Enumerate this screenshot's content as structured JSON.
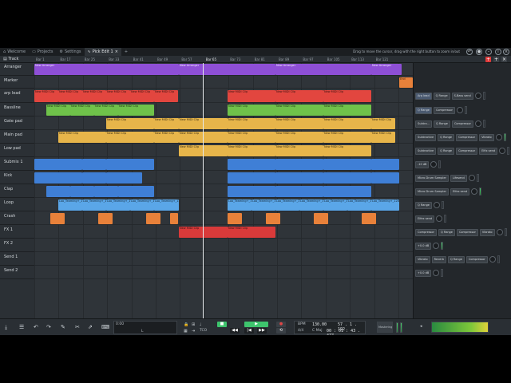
{
  "colors": {
    "arranger": "#8e4fd6",
    "red": "#e2463f",
    "green": "#6fc24a",
    "yellow": "#e7b54a",
    "blue": "#3f7fd6",
    "lightblue": "#5aa6e8",
    "orange": "#e8813a",
    "accent_green": "#3ec46d"
  },
  "tabs": [
    {
      "label": "Welcome",
      "icon": "home-icon"
    },
    {
      "label": "Projects",
      "icon": "folder-icon"
    },
    {
      "label": "Settings",
      "icon": "gear-icon"
    },
    {
      "label": "Pick Edit 1",
      "icon": "waveform-icon",
      "active": true
    }
  ],
  "tab_close": "×",
  "tab_add": "+",
  "hint": "Drag to move the cursor, drag with the right button to zoom in/out",
  "toolbar": {
    "track_label": "Track"
  },
  "ruler": [
    "Bar 1",
    "Bar 17",
    "Bar 25",
    "Bar 33",
    "Bar 41",
    "Bar 49",
    "Bar 57",
    "Bar 65",
    "Bar 73",
    "Bar 81",
    "Bar 89",
    "Bar 97",
    "Bar 105",
    "Bar 113",
    "Bar 121"
  ],
  "tracks": [
    {
      "name": "Arranger"
    },
    {
      "name": "Marker"
    },
    {
      "name": "arp lead"
    },
    {
      "name": "Bassline"
    },
    {
      "name": "Gate pad"
    },
    {
      "name": "Main pad"
    },
    {
      "name": "Low pad"
    },
    {
      "name": "Submix 1"
    },
    {
      "name": "Kick"
    },
    {
      "name": "Clap"
    },
    {
      "name": "Loop"
    },
    {
      "name": "Crash"
    },
    {
      "name": "FX 1"
    },
    {
      "name": "FX 2"
    },
    {
      "name": "Send 1"
    },
    {
      "name": "Send 2"
    }
  ],
  "clip_labels": {
    "arranger": "New Arranger",
    "midi": "New MIDI Clip",
    "audio": "Loo_Teaming+_128_1/07",
    "marker": "End"
  },
  "strip": [
    {
      "plugins": [
        "Arp lead",
        "Q Range",
        "S-Bass send"
      ]
    },
    {
      "plugins": [
        "Q Range",
        "Compressor"
      ]
    },
    {
      "plugins": [
        "Subtra...",
        "Q Range",
        "Compressor"
      ]
    },
    {
      "plugins": [
        "Subtractive",
        "Q Range",
        "Compressor",
        "Vibrato"
      ]
    },
    {
      "plugins": [
        "Subtractive",
        "Q Range",
        "Compressor",
        "Elfix send"
      ]
    },
    {
      "plugins": [
        "-10 dB"
      ]
    },
    {
      "plugins": [
        "Micro Drum Sampler",
        "Lifesend"
      ]
    },
    {
      "plugins": [
        "Micro Drum Sampler",
        "Elfex send"
      ]
    },
    {
      "plugins": [
        "Q Range"
      ]
    },
    {
      "plugins": [
        "Elfex send"
      ]
    },
    {
      "plugins": [
        "Compressor",
        "Q Range",
        "Compressor",
        "Vibrato"
      ]
    },
    {
      "plugins": [
        "+0.0 dB"
      ]
    },
    {
      "plugins": [
        "Vibrato",
        "Reverb",
        "Q Range",
        "Compressor"
      ]
    },
    {
      "plugins": [
        "+0.0 dB"
      ]
    }
  ],
  "transport": {
    "bpm_label": "BPM",
    "bpm": "130.00",
    "sig": "4/4",
    "key": "C Maj",
    "position": "57 . 1 . 192",
    "time": "00 : 01 : 43 . 477",
    "pos_label": "TCO",
    "mastering": "Mastering",
    "sync_label": "0:00",
    "loop_label": "L"
  }
}
